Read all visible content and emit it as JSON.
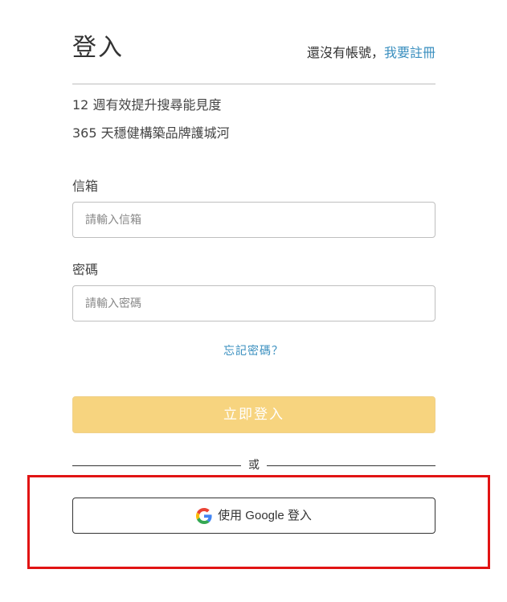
{
  "header": {
    "title": "登入",
    "no_account_text": "還沒有帳號，",
    "register_link": "我要註冊"
  },
  "subtitles": [
    "12 週有效提升搜尋能見度",
    "365 天穩健構築品牌護城河"
  ],
  "form": {
    "email_label": "信箱",
    "email_placeholder": "請輸入信箱",
    "email_value": "",
    "password_label": "密碼",
    "password_placeholder": "請輸入密碼",
    "password_value": "",
    "forgot_link": "忘記密碼？",
    "submit_label": "立即登入"
  },
  "divider": {
    "text": "或"
  },
  "google": {
    "label": "使用 Google 登入",
    "icon": "google-g-icon"
  },
  "colors": {
    "link": "#3a8fbf",
    "submit_bg": "#f7d47f",
    "highlight": "#e11414"
  }
}
